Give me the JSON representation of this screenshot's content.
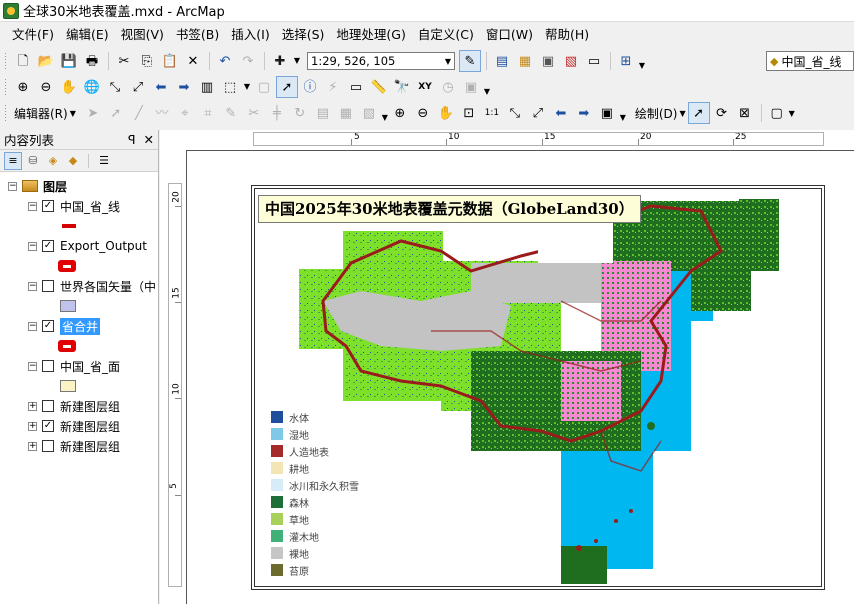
{
  "window": {
    "title": "全球30米地表覆盖.mxd - ArcMap"
  },
  "menu": [
    "文件(F)",
    "编辑(E)",
    "视图(V)",
    "书签(B)",
    "插入(I)",
    "选择(S)",
    "地理处理(G)",
    "自定义(C)",
    "窗口(W)",
    "帮助(H)"
  ],
  "toolbar": {
    "scale_value": "1:29, 526, 105",
    "target_layer": "中国_省_线",
    "editor_label": "编辑器(R)",
    "draw_label": "绘制(D)"
  },
  "toc": {
    "title": "内容列表",
    "pin": "ᵖ",
    "close": "✕",
    "root_label": "图层",
    "layers": [
      {
        "name": "中国_省_线",
        "checked": true,
        "symbol": "line"
      },
      {
        "name": "Export_Output",
        "checked": true,
        "symbol": "red"
      },
      {
        "name": "世界各国矢量（中",
        "checked": false,
        "symbol": "poly",
        "fill": "#c0c4ec"
      },
      {
        "name": "省合并",
        "checked": true,
        "symbol": "red",
        "selected": true
      },
      {
        "name": "中国_省_面",
        "checked": false,
        "symbol": "poly",
        "fill": "#fbf3c3"
      }
    ],
    "groups": [
      {
        "name": "新建图层组",
        "checked": false
      },
      {
        "name": "新建图层组",
        "checked": true
      },
      {
        "name": "新建图层组",
        "checked": false
      }
    ]
  },
  "rulers": {
    "top": [
      "5",
      "10",
      "15",
      "20",
      "25"
    ],
    "left": [
      "20",
      "15",
      "10",
      "5"
    ]
  },
  "map": {
    "title": "中国2025年30米地表覆盖元数据（GlobeLand30）",
    "legend": [
      {
        "label": "水体",
        "color": "#1f4e9c"
      },
      {
        "label": "湿地",
        "color": "#7ec8e8"
      },
      {
        "label": "人造地表",
        "color": "#a52a2a"
      },
      {
        "label": "耕地",
        "color": "#f3e5b5"
      },
      {
        "label": "冰川和永久积雪",
        "color": "#d6ecf7"
      },
      {
        "label": "森林",
        "color": "#1e6e3a"
      },
      {
        "label": "草地",
        "color": "#a7d15a"
      },
      {
        "label": "灌木地",
        "color": "#3fb07a"
      },
      {
        "label": "裸地",
        "color": "#c6c6c6"
      },
      {
        "label": "苔原",
        "color": "#6b6b2e"
      }
    ],
    "colors": {
      "ocean": "#00b7f0",
      "grass": "#7ee02a",
      "bare": "#c3c3c3",
      "forest": "#1f6e1f",
      "urban": "#f58ad2",
      "boundary": "#9a1b1b"
    }
  }
}
